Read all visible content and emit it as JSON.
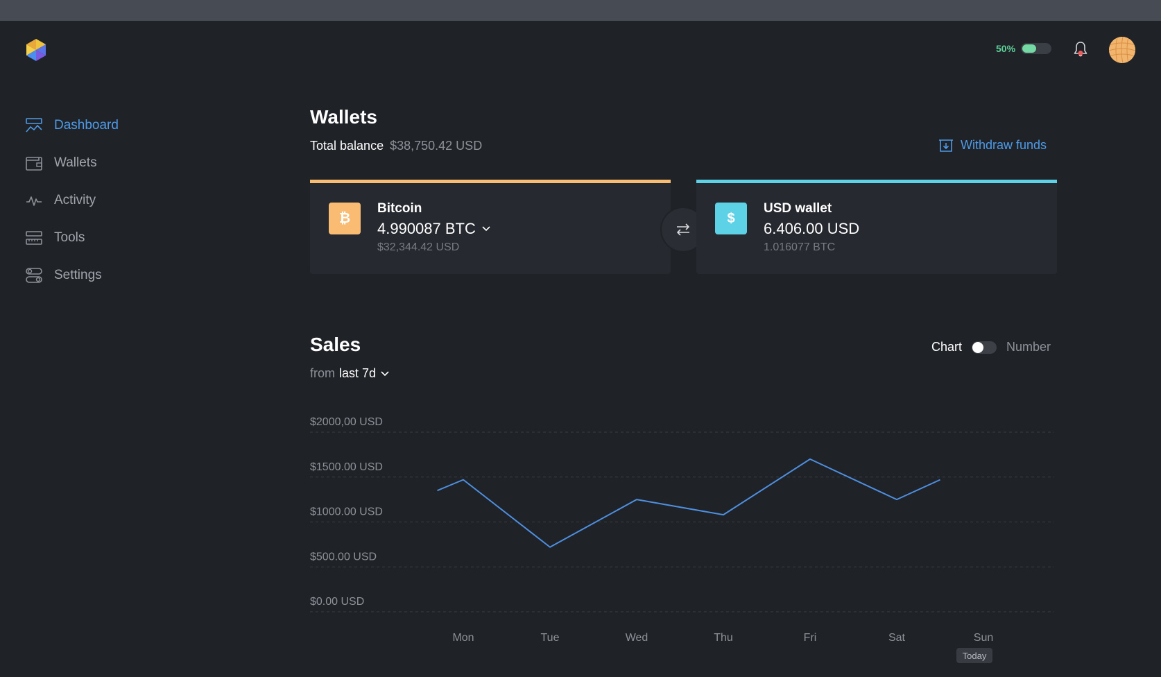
{
  "theme": {
    "accent": "#4e9be8",
    "bitcoin": "#f9bc72",
    "usd": "#5dd2e6",
    "battery": "#74d9a4",
    "notification_dot": "#ef5b5b"
  },
  "header": {
    "battery_percent": "50%",
    "battery_level": 0.5,
    "logo_icon": "hexagon-logo-icon",
    "notification_icon": "bell-icon"
  },
  "sidebar": {
    "items": [
      {
        "label": "Dashboard",
        "icon": "dashboard-icon",
        "active": true
      },
      {
        "label": "Wallets",
        "icon": "wallet-icon",
        "active": false
      },
      {
        "label": "Activity",
        "icon": "activity-icon",
        "active": false
      },
      {
        "label": "Tools",
        "icon": "tools-icon",
        "active": false
      },
      {
        "label": "Settings",
        "icon": "settings-icon",
        "active": false
      }
    ]
  },
  "wallets": {
    "title": "Wallets",
    "total_label": "Total balance",
    "total_value": "$38,750.42 USD",
    "withdraw_label": "Withdraw funds",
    "cards": [
      {
        "name": "Bitcoin",
        "symbol": "₿",
        "amount": "4.990087 BTC",
        "sub": "$32,344.42 USD",
        "color": "#f9bc72"
      },
      {
        "name": "USD wallet",
        "symbol": "$",
        "amount": "6.406.00 USD",
        "sub": "1.016077 BTC",
        "color": "#5dd2e6"
      }
    ]
  },
  "sales": {
    "title": "Sales",
    "range_prefix": "from",
    "range_value": "last 7d",
    "view_options": [
      "Chart",
      "Number"
    ],
    "selected_view": "Chart",
    "today_label": "Today"
  },
  "chart_data": {
    "type": "line",
    "categories": [
      "Mon",
      "Tue",
      "Wed",
      "Thu",
      "Fri",
      "Sat",
      "Sun"
    ],
    "x": [
      -0.3,
      0,
      1,
      2,
      3,
      4,
      5,
      5.5
    ],
    "values": [
      1350,
      1470,
      720,
      1250,
      1080,
      1700,
      1250,
      1470
    ],
    "y_ticks": [
      0,
      500,
      1000,
      1500,
      2000
    ],
    "y_tick_labels": [
      "$0.00 USD",
      "$500.00 USD",
      "$1000.00 USD",
      "$1500.00 USD",
      "$2000,00 USD"
    ],
    "ylim": [
      0,
      2000
    ],
    "grid": true,
    "line_color": "#4e8fe0",
    "title": "",
    "xlabel": "",
    "ylabel": ""
  }
}
